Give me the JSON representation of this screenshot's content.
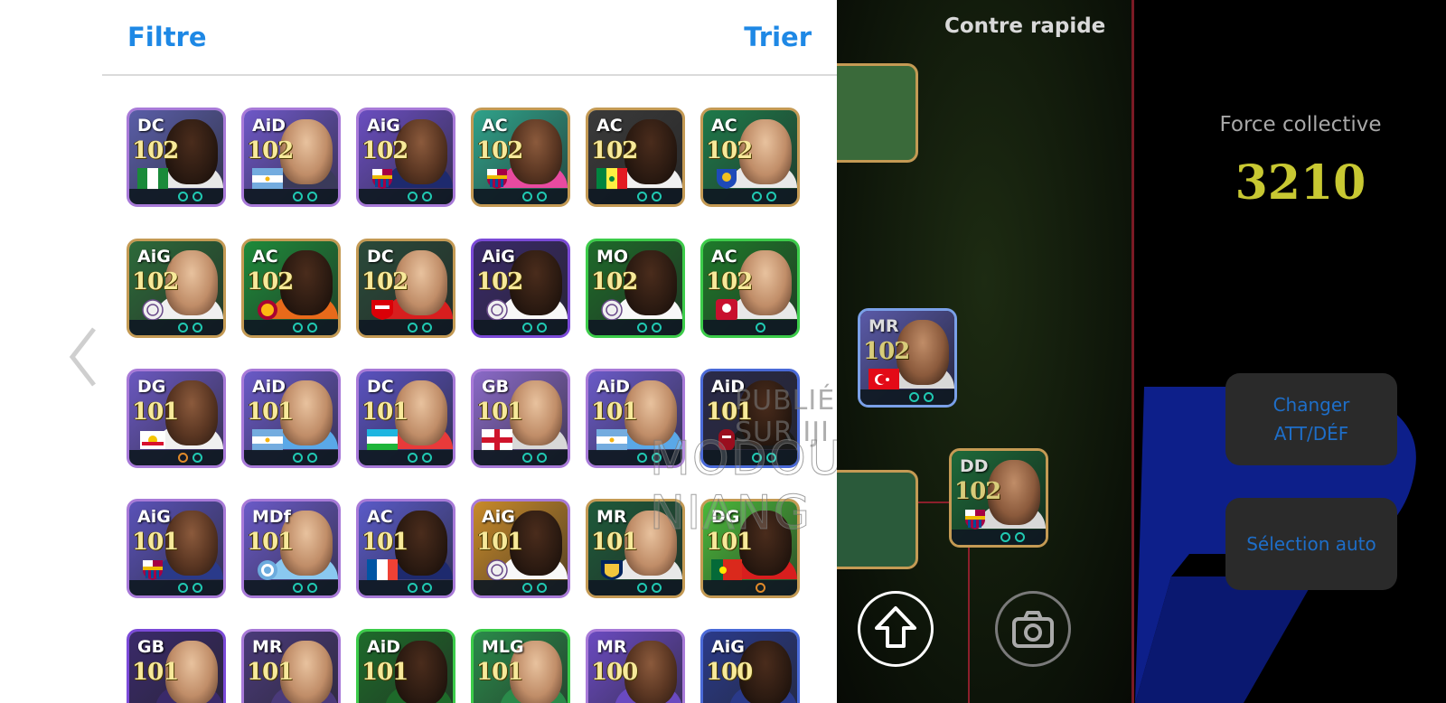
{
  "panel": {
    "filter_label": "Filtre",
    "sort_label": "Trier"
  },
  "players": [
    {
      "pos": "DC",
      "rating": "102",
      "border": "#a87ad8",
      "bg": "#5a5ea8",
      "flag": "nigeria",
      "skin": "dark",
      "shirt": "#e8e8e8",
      "dots": 2
    },
    {
      "pos": "AiD",
      "rating": "102",
      "border": "#a87ad8",
      "bg": "#6e58c8",
      "flag": "argentina",
      "skin": "light",
      "shirt": "#3a3a5a",
      "dots": 2
    },
    {
      "pos": "AiG",
      "rating": "102",
      "border": "#a87ad8",
      "bg": "#6a4ec0",
      "flag": "barcelona",
      "skin": "mid",
      "shirt": "#1e2a6e",
      "dots": 2
    },
    {
      "pos": "AC",
      "rating": "102",
      "border": "#c49a54",
      "bg": "#2fa28a",
      "flag": "barcelona",
      "skin": "mid",
      "shirt": "#e84aa0",
      "dots": 2
    },
    {
      "pos": "AC",
      "rating": "102",
      "border": "#c49a54",
      "bg": "#3a3a3a",
      "flag": "senegal",
      "skin": "dark",
      "shirt": "#f0f0f0",
      "dots": 2
    },
    {
      "pos": "AC",
      "rating": "102",
      "border": "#c49a54",
      "bg": "#1e7a4a",
      "flag": "club-blue",
      "skin": "light",
      "shirt": "#e8e8e8",
      "dots": 2
    },
    {
      "pos": "AiG",
      "rating": "102",
      "border": "#c49a54",
      "bg": "#2d6a3a",
      "flag": "club-white",
      "skin": "light",
      "shirt": "#f0f0f0",
      "dots": 2
    },
    {
      "pos": "AC",
      "rating": "102",
      "border": "#c49a54",
      "bg": "#1e8a3a",
      "flag": "galatasaray",
      "skin": "dark",
      "shirt": "#e86a1a",
      "dots": 2
    },
    {
      "pos": "DC",
      "rating": "102",
      "border": "#c49a54",
      "bg": "#2a4a3a",
      "flag": "arsenal",
      "skin": "light",
      "shirt": "#d81e1e",
      "dots": 2
    },
    {
      "pos": "AiG",
      "rating": "102",
      "border": "#7b4ad8",
      "bg": "#3a2a6a",
      "flag": "club-white",
      "skin": "dark",
      "shirt": "#f8f8f8",
      "dots": 2
    },
    {
      "pos": "MO",
      "rating": "102",
      "border": "#3ccc4a",
      "bg": "#1e6a2a",
      "flag": "club-white",
      "skin": "dark",
      "shirt": "#f8f8f8",
      "dots": 2
    },
    {
      "pos": "AC",
      "rating": "102",
      "border": "#3ccc4a",
      "bg": "#1e7a2a",
      "flag": "club-red",
      "skin": "light",
      "shirt": "#e8e8e8",
      "dots": 1
    },
    {
      "pos": "DG",
      "rating": "101",
      "border": "#a87ad8",
      "bg": "#6a58c0",
      "flag": "club-redbull",
      "skin": "mid",
      "shirt": "#f0f0f0",
      "dots": 2,
      "orange": true
    },
    {
      "pos": "AiD",
      "rating": "101",
      "border": "#a87ad8",
      "bg": "#6a5ac8",
      "flag": "argentina",
      "skin": "light",
      "shirt": "#5aa8e8",
      "dots": 2
    },
    {
      "pos": "DC",
      "rating": "101",
      "border": "#a87ad8",
      "bg": "#5a52c0",
      "flag": "uzbekistan",
      "skin": "light",
      "shirt": "#e83a3a",
      "dots": 2
    },
    {
      "pos": "GB",
      "rating": "101",
      "border": "#a87ad8",
      "bg": "#8a6ac8",
      "flag": "england",
      "skin": "light",
      "shirt": "#d8d8d8",
      "dots": 2
    },
    {
      "pos": "AiD",
      "rating": "101",
      "border": "#a87ad8",
      "bg": "#6a5ac8",
      "flag": "argentina",
      "skin": "light",
      "shirt": "#5aa8e8",
      "dots": 2
    },
    {
      "pos": "AiD",
      "rating": "101",
      "border": "#4a6ad8",
      "bg": "#2a2a4a",
      "flag": "club-red2",
      "skin": "dark",
      "shirt": "#1a1a1a",
      "dots": 2
    },
    {
      "pos": "AiG",
      "rating": "101",
      "border": "#a87ad8",
      "bg": "#5a52b8",
      "flag": "barcelona",
      "skin": "mid",
      "shirt": "#2a3a8a",
      "dots": 2
    },
    {
      "pos": "MDf",
      "rating": "101",
      "border": "#a87ad8",
      "bg": "#6a5ac8",
      "flag": "club-sky",
      "skin": "light",
      "shirt": "#8ac8f0",
      "dots": 2
    },
    {
      "pos": "AC",
      "rating": "101",
      "border": "#a87ad8",
      "bg": "#5a5ac8",
      "flag": "france",
      "skin": "dark",
      "shirt": "#1e2a6e",
      "dots": 2
    },
    {
      "pos": "AiG",
      "rating": "101",
      "border": "#a87ad8",
      "bg": "#c88a2a",
      "flag": "club-white",
      "skin": "dark",
      "shirt": "#f8f8f8",
      "dots": 2
    },
    {
      "pos": "MR",
      "rating": "101",
      "border": "#c49a54",
      "bg": "#1e5a3a",
      "flag": "club-lag",
      "skin": "light",
      "shirt": "#e8e8e8",
      "dots": 2
    },
    {
      "pos": "DG",
      "rating": "101",
      "border": "#c49a54",
      "bg": "#4ab83a",
      "flag": "portugal",
      "skin": "dark",
      "shirt": "#d81e1e",
      "dots": 1,
      "orange": true
    },
    {
      "pos": "GB",
      "rating": "101",
      "border": "#7b4ad8",
      "bg": "#3a2a6a",
      "flag": "none",
      "skin": "light",
      "shirt": "#3a2a6a",
      "dots": 0
    },
    {
      "pos": "MR",
      "rating": "101",
      "border": "#a87ad8",
      "bg": "#4a3a7a",
      "flag": "none",
      "skin": "light",
      "shirt": "#4a3a7a",
      "dots": 0
    },
    {
      "pos": "AiD",
      "rating": "101",
      "border": "#3ccc4a",
      "bg": "#1e6a2a",
      "flag": "none",
      "skin": "dark",
      "shirt": "#1e6a2a",
      "dots": 0
    },
    {
      "pos": "MLG",
      "rating": "101",
      "border": "#3ccc4a",
      "bg": "#2a8a4a",
      "flag": "none",
      "skin": "light",
      "shirt": "#2a8a4a",
      "dots": 0
    },
    {
      "pos": "MR",
      "rating": "100",
      "border": "#a87ad8",
      "bg": "#6a4ac0",
      "flag": "none",
      "skin": "mid",
      "shirt": "#6a4ac0",
      "dots": 0
    },
    {
      "pos": "AiG",
      "rating": "100",
      "border": "#4a6ad8",
      "bg": "#2a3a8a",
      "flag": "none",
      "skin": "dark",
      "shirt": "#2a3a8a",
      "dots": 0
    }
  ],
  "watermark": {
    "line1": "PUBLIÉ SUR IJI",
    "line2": "MODOU NIANG"
  },
  "pitch_players": [
    {
      "pos": "MR",
      "rating": "102",
      "flag": "turkey",
      "border": "#7aa0e8",
      "bg": "#5a5aa8"
    },
    {
      "pos": "DD",
      "rating": "102",
      "flag": "barcelona",
      "border": "#c49a54",
      "bg": "#1e6a3a"
    }
  ],
  "mode_title": "Contre rapide",
  "team_strength": {
    "label": "Force collective",
    "value": "3210"
  },
  "buttons": {
    "switch_att_def_line1": "Changer",
    "switch_att_def_line2": "ATT/DÉF",
    "auto_select": "Sélection auto"
  },
  "icons": {
    "back": "chevron-left-icon",
    "upload": "upload-arrow-icon",
    "camera": "camera-icon"
  }
}
